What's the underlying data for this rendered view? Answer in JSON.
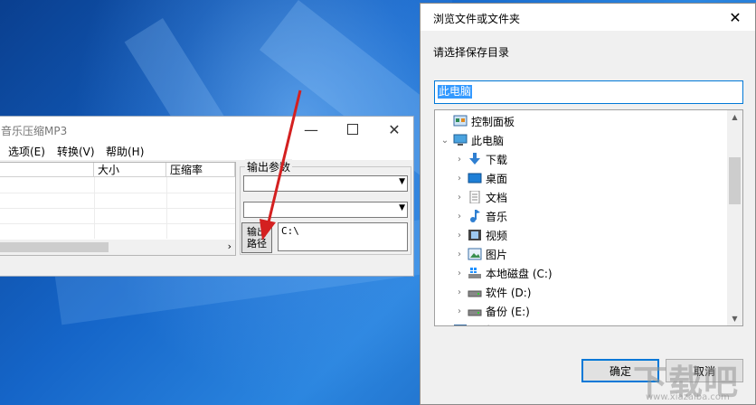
{
  "app": {
    "title": "音乐压缩MP3",
    "menu": [
      "选项(E)",
      "转换(V)",
      "帮助(H)"
    ],
    "columns": [
      "大小",
      "压缩率"
    ],
    "group_label": "输出参数",
    "output_button": "输出\n路径",
    "output_path": "C:\\"
  },
  "dialog": {
    "title": "浏览文件或文件夹",
    "prompt": "请选择保存目录",
    "folder_value": "此电脑",
    "tree": [
      {
        "label": "控制面板",
        "icon": "control-panel-icon",
        "level": 0,
        "expander": "none"
      },
      {
        "label": "此电脑",
        "icon": "computer-icon",
        "level": 0,
        "expander": "expanded"
      },
      {
        "label": "下载",
        "icon": "download-icon",
        "level": 1,
        "expander": "collapsed"
      },
      {
        "label": "桌面",
        "icon": "desktop-icon",
        "level": 1,
        "expander": "collapsed"
      },
      {
        "label": "文档",
        "icon": "document-icon",
        "level": 1,
        "expander": "collapsed"
      },
      {
        "label": "音乐",
        "icon": "music-icon",
        "level": 1,
        "expander": "collapsed"
      },
      {
        "label": "视频",
        "icon": "video-icon",
        "level": 1,
        "expander": "collapsed"
      },
      {
        "label": "图片",
        "icon": "pictures-icon",
        "level": 1,
        "expander": "collapsed"
      },
      {
        "label": "本地磁盘 (C:)",
        "icon": "windows-drive-icon",
        "level": 1,
        "expander": "collapsed"
      },
      {
        "label": "软件 (D:)",
        "icon": "drive-icon",
        "level": 1,
        "expander": "collapsed"
      },
      {
        "label": "备份 (E:)",
        "icon": "drive-icon",
        "level": 1,
        "expander": "collapsed"
      },
      {
        "label": "网络",
        "icon": "network-icon",
        "level": 0,
        "expander": "none"
      }
    ],
    "ok_label": "确定",
    "cancel_label": "取消"
  },
  "watermark": {
    "main": "下载吧",
    "sub": "www.xiazaiba.com"
  },
  "colors": {
    "accent": "#0078d7",
    "selection": "#3399ff",
    "arrow": "#d42020"
  }
}
